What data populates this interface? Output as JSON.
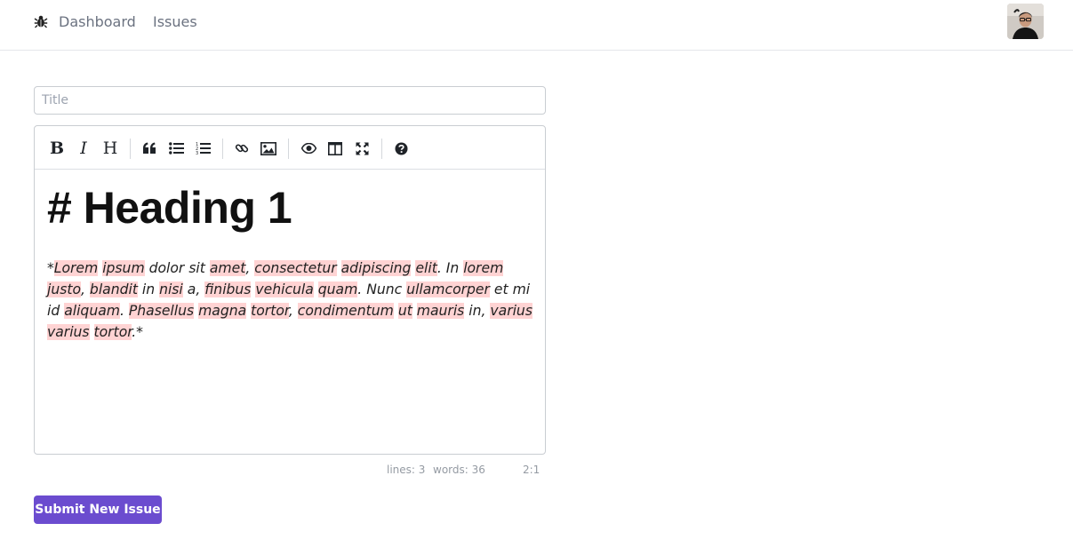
{
  "nav": {
    "logo_icon": "bug-icon",
    "links": {
      "dashboard": "Dashboard",
      "issues": "Issues"
    },
    "avatar_icon": "user-avatar"
  },
  "form": {
    "title_placeholder": "Title",
    "title_value": ""
  },
  "toolbar": {
    "bold_label": "B",
    "italic_label": "I",
    "heading_label": "H",
    "icons": [
      "bold-icon",
      "italic-icon",
      "heading-icon",
      "quote-icon",
      "unordered-list-icon",
      "ordered-list-icon",
      "link-icon",
      "image-icon",
      "preview-icon",
      "side-by-side-icon",
      "fullscreen-icon",
      "help-icon"
    ]
  },
  "editor": {
    "heading": "# Heading 1",
    "paragraph": "*Lorem ipsum dolor sit amet, consectetur adipiscing elit. In lorem justo, blandit in nisi a, finibus vehicula quam. Nunc ullamcorper et mi id aliquam. Phasellus magna tortor, condimentum ut mauris in, varius varius tortor.*",
    "highlighted_words": [
      "Lorem",
      "ipsum",
      "amet",
      "consectetur",
      "adipiscing",
      "elit",
      "lorem",
      "justo",
      "blandit",
      "nisi",
      "finibus",
      "vehicula",
      "quam",
      "ullamcorper",
      "aliquam",
      "Phasellus",
      "magna",
      "tortor",
      "condimentum",
      "ut",
      "mauris",
      "varius"
    ]
  },
  "status": {
    "lines": "lines: 3",
    "words": "words: 36",
    "cursor": "2:1"
  },
  "actions": {
    "submit_label": "Submit New Issue"
  },
  "colors": {
    "primary": "#6b4ccf",
    "highlight": "#ffd3d3",
    "nav_text": "#6b7280"
  }
}
